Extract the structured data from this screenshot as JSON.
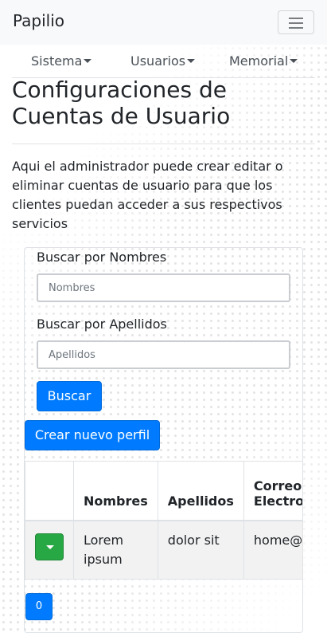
{
  "navbar": {
    "brand": "Papilio"
  },
  "menu": [
    {
      "label": "Sistema"
    },
    {
      "label": "Usuarios"
    },
    {
      "label": "Memorial"
    }
  ],
  "page": {
    "title": "Configuraciones de Cuentas de Usuario",
    "description": "Aqui el administrador puede crear editar o eliminar cuentas de usuario para que los clientes puedan acceder a sus respectivos servicios"
  },
  "search": {
    "names_label": "Buscar por Nombres",
    "names_placeholder": "Nombres",
    "surnames_label": "Buscar por Apellidos",
    "surnames_placeholder": "Apellidos",
    "search_button": "Buscar"
  },
  "create_button": "Crear nuevo perfil",
  "table": {
    "headers": [
      "",
      "Nombres",
      "Apellidos",
      "Correo Electronico"
    ],
    "rows": [
      {
        "nombres": "Lorem ipsum",
        "apellidos": "dolor sit",
        "correo": "home@ir"
      }
    ]
  },
  "pagination": {
    "current": "0"
  },
  "colors": {
    "primary": "#007bff",
    "success": "#28a745",
    "navbar": "#f8f9fa"
  }
}
